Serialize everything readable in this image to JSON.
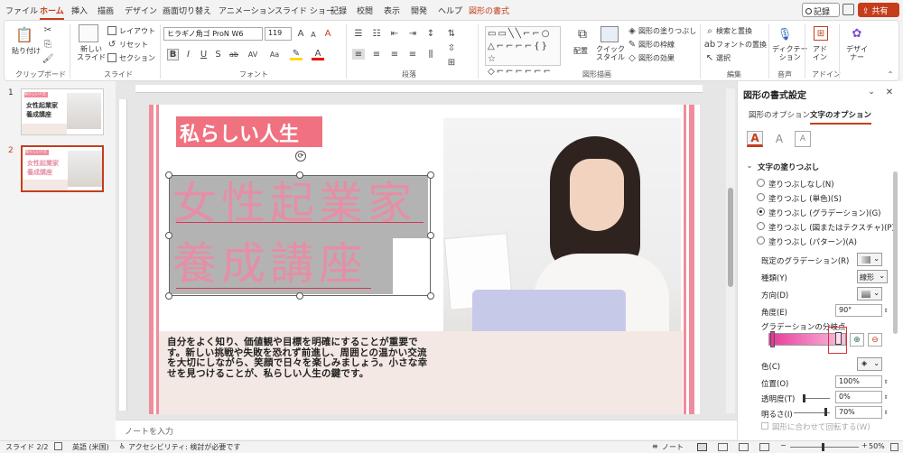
{
  "menu": {
    "tabs": [
      "ファイル",
      "ホーム",
      "挿入",
      "描画",
      "デザイン",
      "画面切り替え",
      "アニメーション",
      "スライド ショー",
      "記録",
      "校閲",
      "表示",
      "開発",
      "ヘルプ",
      "図形の書式"
    ],
    "record_btn": "記録",
    "share_btn": "共有"
  },
  "ribbon": {
    "clipboard": {
      "paste": "貼り付け",
      "label": "クリップボード"
    },
    "slides": {
      "new_slide": "新しい\nスライド",
      "layout": "レイアウト",
      "reset": "リセット",
      "section": "セクション",
      "label": "スライド"
    },
    "font": {
      "name": "ヒラギノ角ゴ ProN W6",
      "size": "119",
      "bold": "B",
      "italic": "I",
      "underline": "U",
      "strike": "S",
      "shadow": "ab",
      "spacing": "AV",
      "case": "Aa",
      "label": "フォント"
    },
    "paragraph": {
      "label": "段落"
    },
    "drawing": {
      "arrange": "配置",
      "quick_styles": "クイック\nスタイル",
      "fill": "図形の塗りつぶし",
      "outline": "図形の枠線",
      "effects": "図形の効果",
      "label": "図形描画"
    },
    "editing": {
      "find": "検索と置換",
      "replace_font": "フォントの置換",
      "select": "選択",
      "label": "編集"
    },
    "voice": {
      "dictate": "ディクテー\nション",
      "label": "音声"
    },
    "addins": {
      "addins": "アド\nイン",
      "label": "アドイン"
    },
    "designer": {
      "designer": "デザイ\nナー"
    }
  },
  "thumbnails": [
    {
      "num": "1",
      "tag": "私らしい人生",
      "title1": "女性起業家",
      "title2": "養成講座"
    },
    {
      "num": "2",
      "tag": "私らしい人生",
      "title1": "女性起業家",
      "title2": "養成講座"
    }
  ],
  "slide": {
    "tag": "私らしい人生",
    "title1": "女性起業家",
    "title2": "養成講座",
    "body": "自分をよく知り、価値観や目標を明確にすることが重要です。新しい挑戦や失敗を恐れず前進し、周囲との温かい交流を大切にしながら、笑顔で日々を楽しみましょう。小さな幸せを見つけることが、私らしい人生の鍵です。"
  },
  "notes_placeholder": "ノートを入力",
  "pane": {
    "title": "図形の書式設定",
    "tab_shape": "図形のオプション",
    "tab_text": "文字のオプション",
    "section": "文字の塗りつぶし",
    "options": [
      {
        "label": "塗りつぶしなし(N)",
        "on": false
      },
      {
        "label": "塗りつぶし (単色)(S)",
        "on": false
      },
      {
        "label": "塗りつぶし (グラデーション)(G)",
        "on": true
      },
      {
        "label": "塗りつぶし (図またはテクスチャ)(P)",
        "on": false
      },
      {
        "label": "塗りつぶし (パターン)(A)",
        "on": false
      }
    ],
    "preset_label": "既定のグラデーション(R)",
    "type_label": "種類(Y)",
    "type_value": "線形",
    "direction_label": "方向(D)",
    "angle_label": "角度(E)",
    "angle_value": "90°",
    "stops_label": "グラデーションの分岐点",
    "color_label": "色(C)",
    "position_label": "位置(O)",
    "position_value": "100%",
    "transparency_label": "透明度(T)",
    "transparency_value": "0%",
    "brightness_label": "明るさ(I)",
    "brightness_value": "70%",
    "rotate_label": "図形に合わせて回転する(W)"
  },
  "status": {
    "slide": "スライド 2/2",
    "lang": "英語 (米国)",
    "accessibility": "アクセシビリティ: 検討が必要です",
    "notes": "ノート",
    "zoom": "50%"
  },
  "colors": {
    "accent": "#c43e1c",
    "pink": "#f08c9c",
    "title_pink": "#e58fa6",
    "gray": "#b3b3b3"
  }
}
